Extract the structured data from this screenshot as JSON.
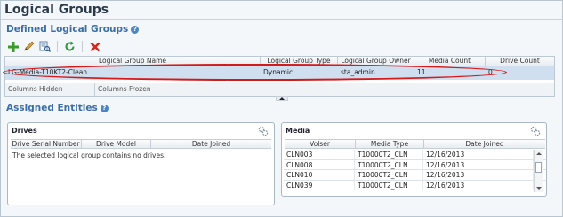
{
  "page": {
    "title": "Logical Groups"
  },
  "defined": {
    "heading": "Defined Logical Groups",
    "help_glyph": "?",
    "toolbar": [
      {
        "name": "add-icon"
      },
      {
        "name": "edit-icon"
      },
      {
        "name": "detail-icon"
      },
      {
        "name": "refresh-icon"
      },
      {
        "name": "delete-icon"
      }
    ],
    "columns": [
      "Logical Group Name",
      "Logical Group Type",
      "Logical Group Owner",
      "Media Count",
      "Drive Count"
    ],
    "rows": [
      {
        "name": "LG-Media-T10KT2-Clean",
        "type": "Dynamic",
        "owner": "sta_admin",
        "media_count": "11",
        "drive_count": "0"
      }
    ],
    "footer": {
      "columns_hidden": "Columns Hidden",
      "columns_frozen": "Columns Frozen"
    }
  },
  "assigned": {
    "heading": "Assigned Entities",
    "help_glyph": "?",
    "drives": {
      "title": "Drives",
      "columns": [
        "Drive Serial Number",
        "Drive Model",
        "Date Joined"
      ],
      "empty_message": "The selected logical group contains no drives."
    },
    "media": {
      "title": "Media",
      "columns": [
        "Volser",
        "Media Type",
        "Date Joined"
      ],
      "rows": [
        {
          "volser": "CLN003",
          "type": "T10000T2_CLN",
          "date": "12/16/2013"
        },
        {
          "volser": "CLN008",
          "type": "T10000T2_CLN",
          "date": "12/16/2013"
        },
        {
          "volser": "CLN010",
          "type": "T10000T2_CLN",
          "date": "12/16/2013"
        },
        {
          "volser": "CLN039",
          "type": "T10000T2_CLN",
          "date": "12/16/2013"
        }
      ]
    }
  },
  "colors": {
    "accent": "#3b6ea5",
    "selected_row": "#cfdfef",
    "highlight": "#d51818"
  }
}
